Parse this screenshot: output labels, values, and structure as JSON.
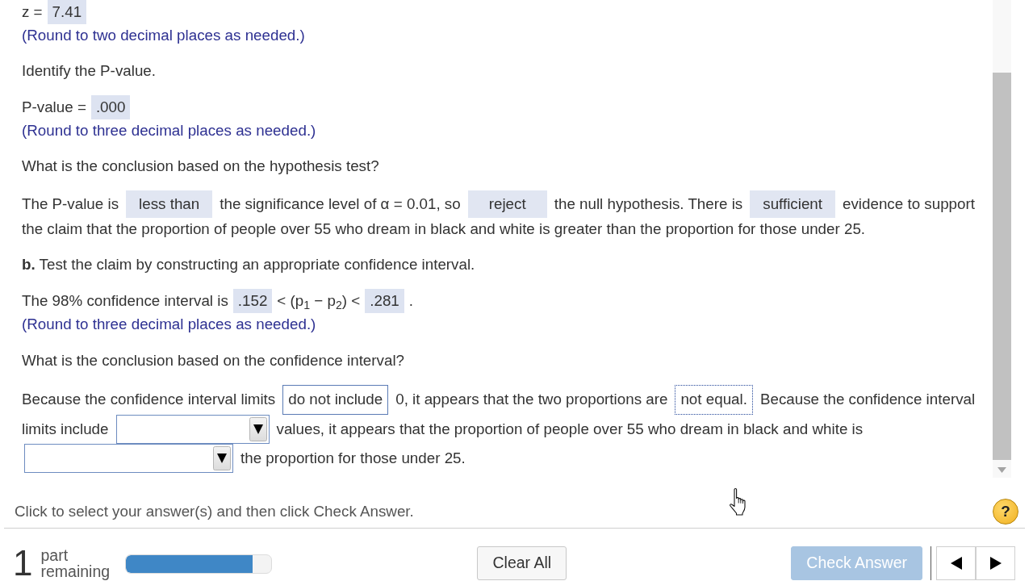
{
  "question": [
    {
      "kind": "prompt",
      "lines": [
        [
          {
            "kind": "text",
            "text": "z ="
          },
          {
            "kind": "answer",
            "value": "7.41"
          }
        ]
      ]
    },
    {
      "kind": "hint",
      "text": "(Round to two decimal places as needed.)"
    },
    {
      "kind": "prompt",
      "lines": [
        [
          {
            "kind": "text",
            "text": "Identify the P-value."
          }
        ]
      ]
    },
    {
      "kind": "prompt",
      "lines": [
        [
          {
            "kind": "text",
            "text": "P-value ="
          },
          {
            "kind": "answer",
            "value": ".000"
          }
        ]
      ]
    },
    {
      "kind": "hint",
      "text": "(Round to three decimal places as needed.)"
    },
    {
      "kind": "prompt",
      "lines": [
        [
          {
            "kind": "text",
            "text": "What is the conclusion based on the hypothesis test?"
          }
        ]
      ]
    },
    {
      "kind": "prompt",
      "lines": [
        [
          {
            "kind": "text",
            "text": "The P-value is"
          },
          {
            "kind": "choice",
            "value": "less than"
          },
          {
            "kind": "text",
            "text": "the significance level of α = 0.01, so"
          },
          {
            "kind": "choice",
            "value": "reject"
          },
          {
            "kind": "text",
            "text": "the null hypothesis. There is"
          },
          {
            "kind": "choice",
            "value": "sufficient"
          },
          {
            "kind": "text",
            "text": "evidence to support"
          }
        ],
        [
          {
            "kind": "text",
            "text": "the claim that the proportion of people over 55 who dream in black and white is greater than the proportion for those under 25."
          }
        ]
      ]
    },
    {
      "kind": "prompt",
      "lines": [
        [
          {
            "kind": "text",
            "text": "**b.** Test the claim by constructing an appropriate confidence interval."
          }
        ]
      ]
    },
    {
      "kind": "prompt",
      "lines": [
        [
          {
            "kind": "text",
            "text": "The 98% confidence interval is"
          },
          {
            "kind": "answer",
            "value": ".152"
          },
          {
            "kind": "text",
            "text": "< (p$_{1}$ − p$_{2}$) <"
          },
          {
            "kind": "answer",
            "value": ".281"
          },
          {
            "kind": "text",
            "text": "."
          }
        ]
      ]
    },
    {
      "kind": "hint",
      "text": "(Round to three decimal places as needed.)"
    },
    {
      "kind": "prompt",
      "lines": [
        [
          {
            "kind": "text",
            "text": "What is the conclusion based on the confidence interval?"
          }
        ]
      ]
    },
    {
      "kind": "prompt",
      "lines": [
        [
          {
            "kind": "text",
            "text": "Because the confidence interval limits"
          },
          {
            "kind": "dropdown",
            "value": "do not include",
            "focused": false
          },
          {
            "kind": "text",
            "text": "0, it appears that the two proportions are"
          },
          {
            "kind": "dropdown",
            "value": "not equal.",
            "focused": true
          },
          {
            "kind": "text",
            "text": "Because the confidence interval"
          }
        ],
        [
          {
            "kind": "text",
            "text": "limits include"
          },
          {
            "kind": "dropdown",
            "focused": false
          },
          {
            "kind": "text",
            "text": "values, it appears that the proportion of people over 55 who dream in black and white is"
          }
        ],
        [
          {
            "kind": "dropdown",
            "focused": false
          },
          {
            "kind": "text",
            "text": "the proportion for those under 25."
          }
        ]
      ]
    }
  ],
  "instruction": "Click to select your answer(s) and then click Check Answer.",
  "help_button": "?",
  "status": {
    "count": "1",
    "label": "part remaining",
    "progress": {
      "level": 0.87
    }
  },
  "buttons": [
    {
      "kind": "secondary",
      "label": "Clear All",
      "disabled": false
    },
    {
      "kind": "primary",
      "label": "Check Answer",
      "disabled": true
    }
  ]
}
